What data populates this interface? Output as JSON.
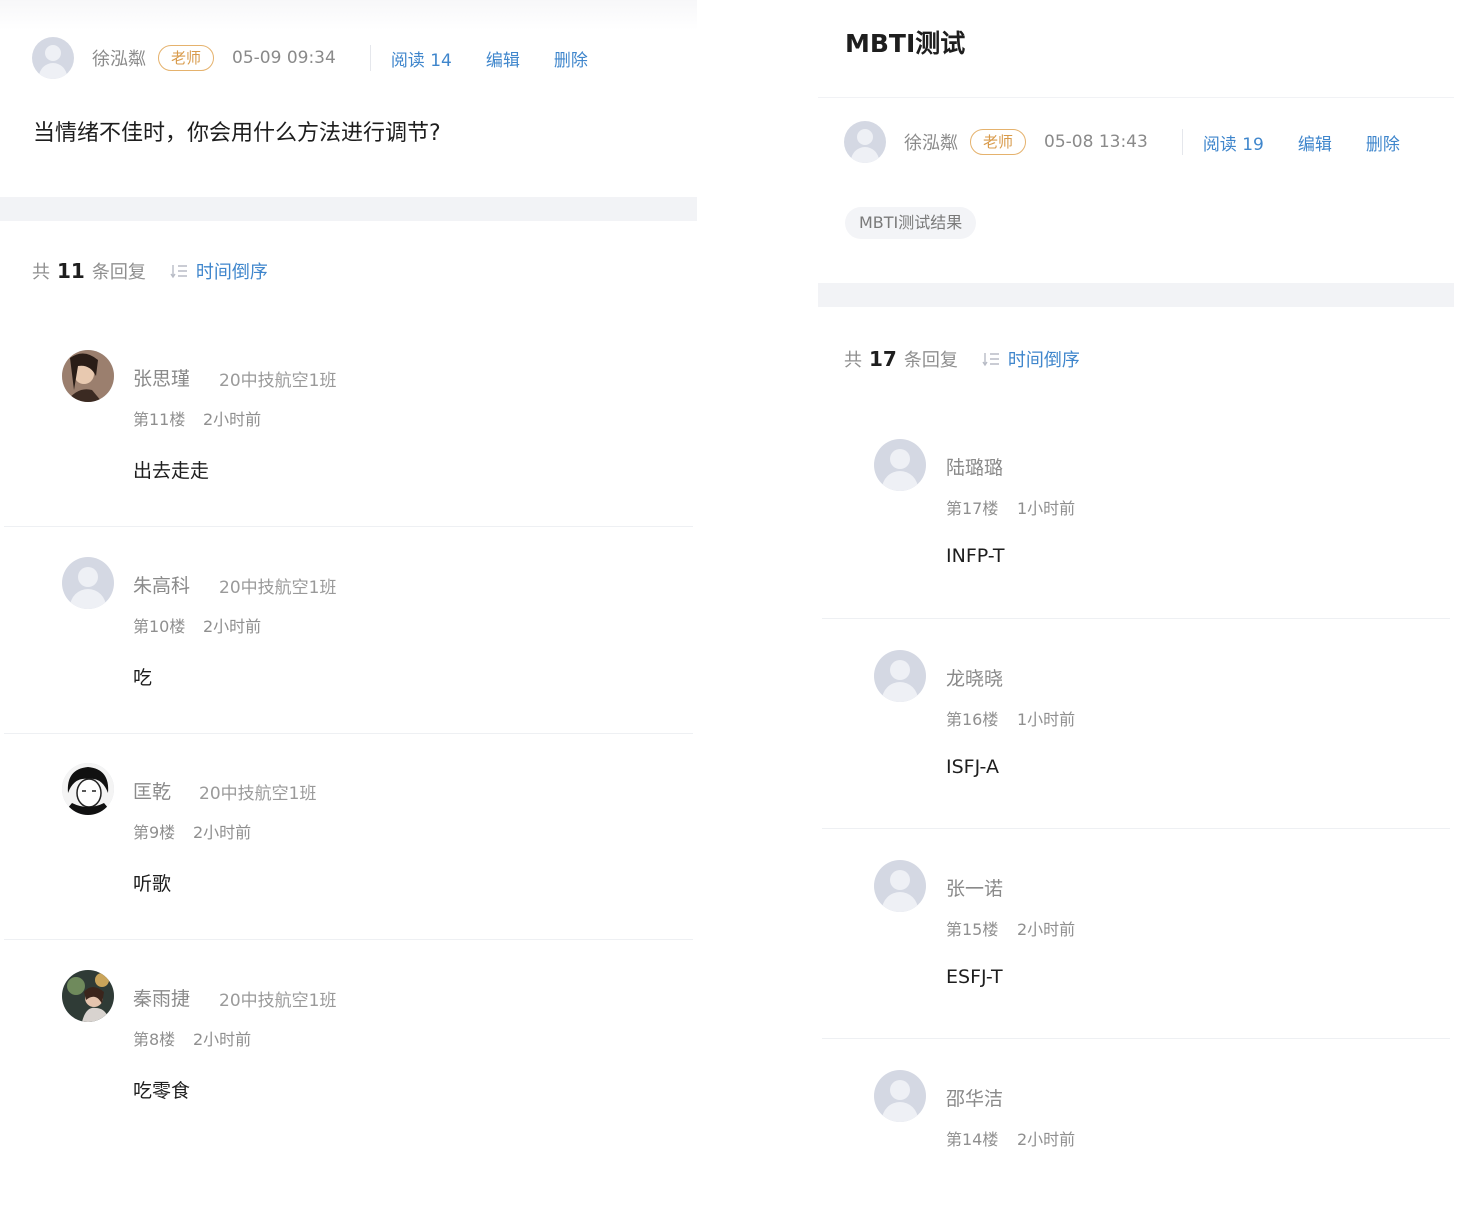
{
  "left": {
    "post": {
      "author": "徐泓粼",
      "role_badge": "老师",
      "date": "05-09 09:34",
      "read_label": "阅读 14",
      "edit_label": "编辑",
      "delete_label": "删除",
      "title": "当情绪不佳时，你会用什么方法进行调节?"
    },
    "reply_bar": {
      "prefix": "共",
      "count": "11",
      "suffix": "条回复",
      "sort_label": "时间倒序"
    },
    "replies": [
      {
        "name": "张思瑾",
        "class": "20中技航空1班",
        "floor": "第11楼",
        "time": "2小时前",
        "content": "出去走走",
        "avatar": "photo-avatar"
      },
      {
        "name": "朱高科",
        "class": "20中技航空1班",
        "floor": "第10楼",
        "time": "2小时前",
        "content": "吃",
        "avatar": "default-avatar"
      },
      {
        "name": "匡乾",
        "class": "20中技航空1班",
        "floor": "第9楼",
        "time": "2小时前",
        "content": "听歌",
        "avatar": "photo-avatar"
      },
      {
        "name": "秦雨捷",
        "class": "20中技航空1班",
        "floor": "第8楼",
        "time": "2小时前",
        "content": "吃零食",
        "avatar": "photo-avatar"
      }
    ]
  },
  "right": {
    "post": {
      "title": "MBTI测试",
      "author": "徐泓粼",
      "role_badge": "老师",
      "date": "05-08 13:43",
      "read_label": "阅读 19",
      "edit_label": "编辑",
      "delete_label": "删除",
      "tag": "MBTI测试结果"
    },
    "reply_bar": {
      "prefix": "共",
      "count": "17",
      "suffix": "条回复",
      "sort_label": "时间倒序"
    },
    "replies": [
      {
        "name": "陆璐璐",
        "floor": "第17楼",
        "time": "1小时前",
        "content": "INFP-T",
        "avatar": "default-avatar"
      },
      {
        "name": "龙晓晓",
        "floor": "第16楼",
        "time": "1小时前",
        "content": "ISFJ-A",
        "avatar": "default-avatar"
      },
      {
        "name": "张一诺",
        "floor": "第15楼",
        "time": "2小时前",
        "content": "ESFJ-T",
        "avatar": "default-avatar"
      },
      {
        "name": "邵华洁",
        "floor": "第14楼",
        "time": "2小时前",
        "content": "",
        "avatar": "default-avatar"
      }
    ]
  },
  "colors": {
    "link": "#3f86cc",
    "badge": "#d89a4a",
    "muted": "#8a8a8a",
    "text": "#1e1e1e"
  }
}
